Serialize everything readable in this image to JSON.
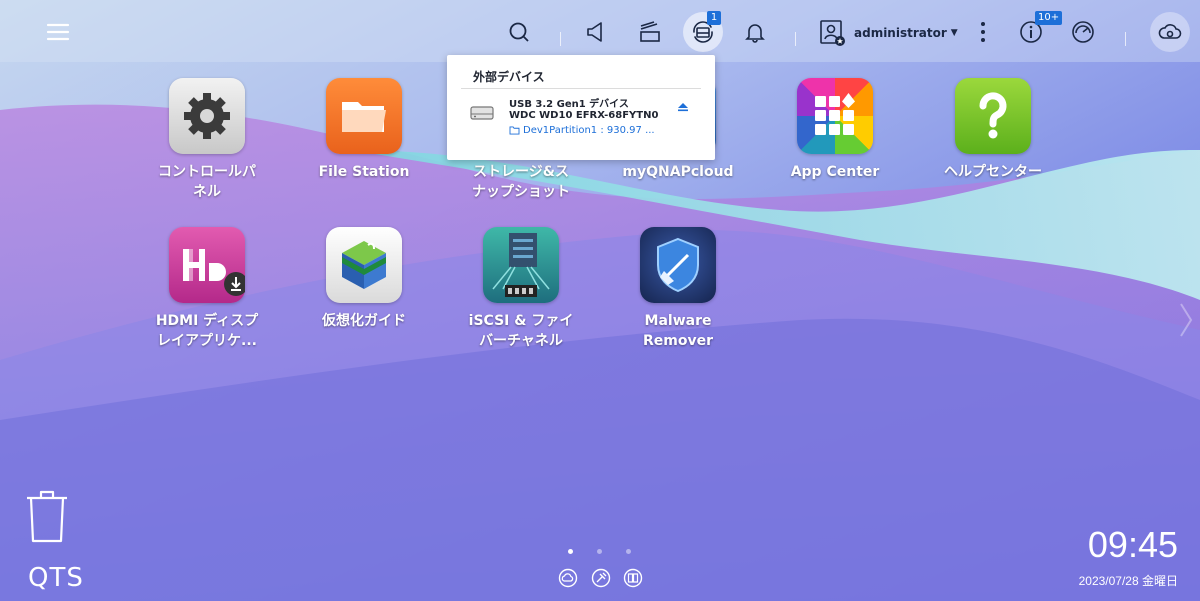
{
  "topbar": {
    "notification_badge": "1",
    "info_badge": "10+",
    "user_name": "administrator"
  },
  "external_devices": {
    "title": "外部デバイス",
    "device": {
      "name_line1": "USB 3.2 Gen1 デバイス",
      "name_line2": "WDC WD10 EFRX-68FYTN0",
      "partition": "Dev1Partition1 : 930.97 ..."
    }
  },
  "apps": [
    {
      "label": "コントロールパ\nネル",
      "icon": "gear-icon"
    },
    {
      "label": "File Station",
      "icon": "folder-icon"
    },
    {
      "label": "ストレージ&ス\nナップショット",
      "icon": "storage-icon"
    },
    {
      "label": "myQNAPcloud",
      "icon": "cloud-icon"
    },
    {
      "label": "App Center",
      "icon": "app-grid-icon"
    },
    {
      "label": "ヘルプセンター",
      "icon": "question-icon"
    },
    {
      "label": "HDMI ディスプ\nレイアプリケ...",
      "icon": "hd-icon"
    },
    {
      "label": "仮想化ガイド",
      "icon": "cube-icon"
    },
    {
      "label": "iSCSI & ファイ\nバーチャネル",
      "icon": "server-icon"
    },
    {
      "label": "Malware\nRemover",
      "icon": "shield-broom-icon"
    }
  ],
  "footer": {
    "logo": "QTS",
    "clock": "09:45",
    "date": "2023/07/28 金曜日",
    "page_count": 3,
    "active_page": 1
  }
}
